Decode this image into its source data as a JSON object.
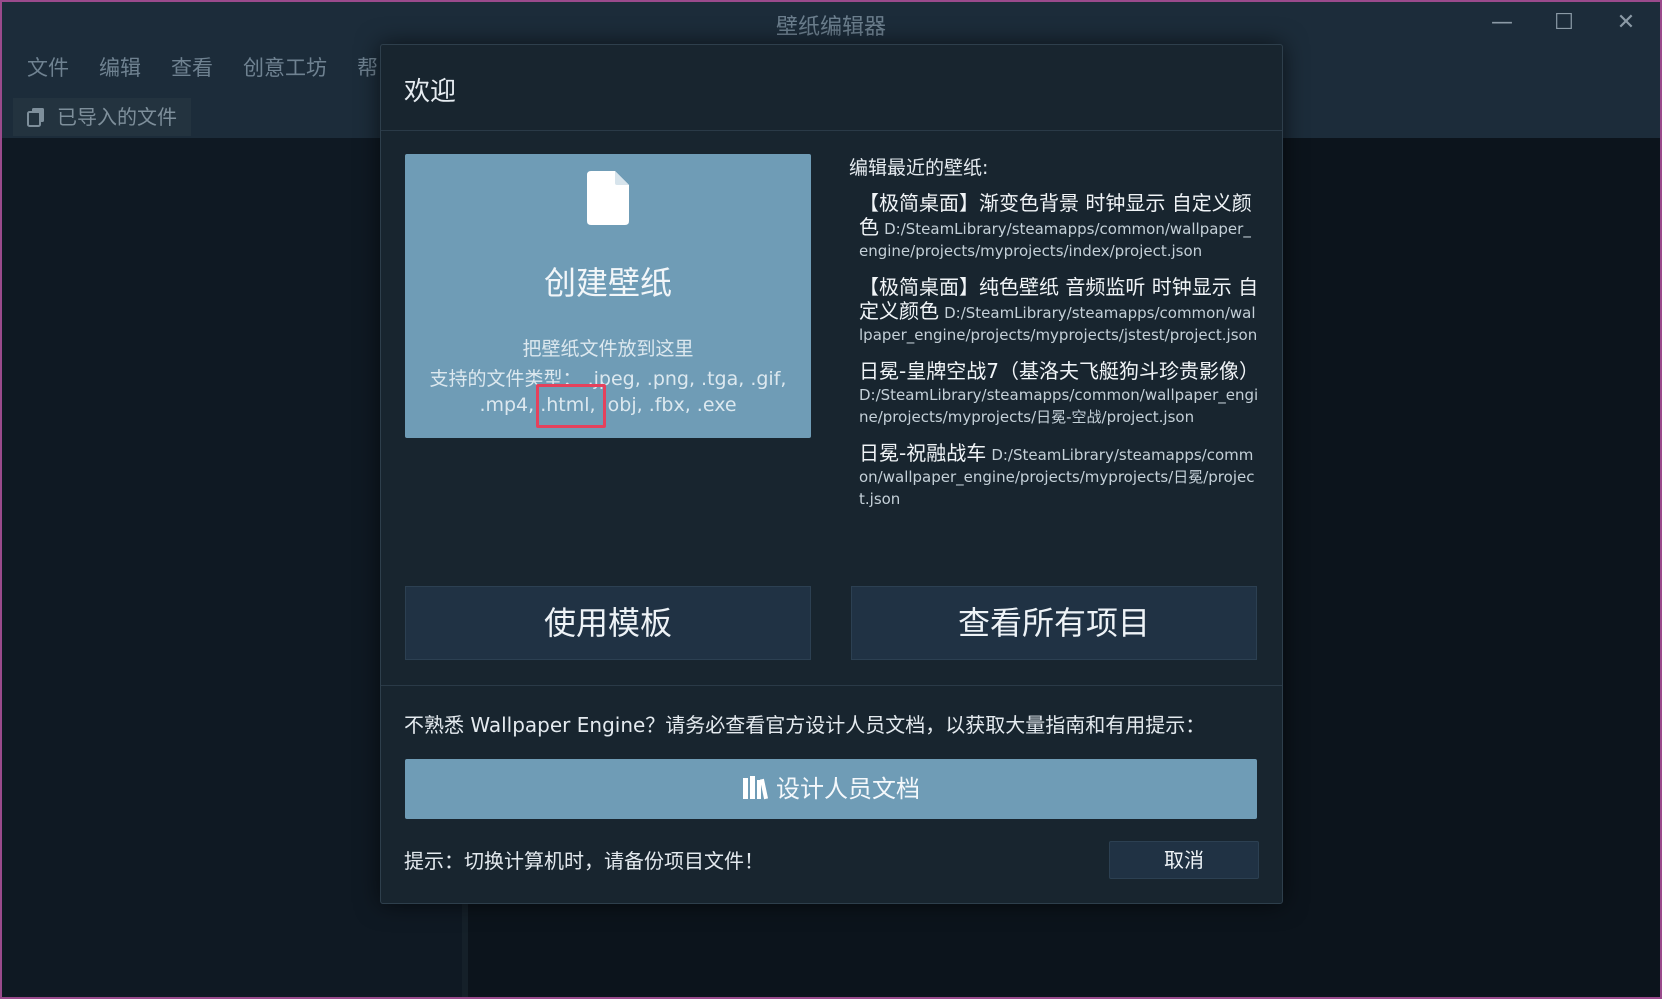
{
  "window": {
    "title": "壁纸编辑器",
    "controls": {
      "minimize": "—",
      "maximize": "☐",
      "close": "✕"
    }
  },
  "menu": [
    "文件",
    "编辑",
    "查看",
    "创意工坊",
    "帮"
  ],
  "tab": {
    "label": "已导入的文件",
    "icon": "copy-icon"
  },
  "dialog": {
    "title": "欢迎",
    "create": {
      "icon": "file-icon",
      "title": "创建壁纸",
      "drop_hint": "把壁纸文件放到这里",
      "types_line1": "支持的文件类型： .jpeg, .png, .tga, .gif,",
      "types_line2": ".mp4, .html, .obj, .fbx, .exe"
    },
    "recent": {
      "heading": "编辑最近的壁纸:",
      "items": [
        {
          "name": "【极简桌面】渐变色背景 时钟显示 自定义颜色",
          "path": "D:/SteamLibrary/steamapps/common/wallpaper_engine/projects/myprojects/index/project.json"
        },
        {
          "name": "【极简桌面】纯色壁纸 音频监听 时钟显示 自定义颜色",
          "path": "D:/SteamLibrary/steamapps/common/wallpaper_engine/projects/myprojects/jstest/project.json"
        },
        {
          "name": "日冕-皇牌空战7（基洛夫飞艇狗斗珍贵影像）",
          "path": "D:/SteamLibrary/steamapps/common/wallpaper_engine/projects/myprojects/日冕-空战/project.json"
        },
        {
          "name": "日冕-祝融战车",
          "path": "D:/SteamLibrary/steamapps/common/wallpaper_engine/projects/myprojects/日冕/project.json"
        }
      ]
    },
    "buttons": {
      "template": "使用模板",
      "all_projects": "查看所有项目",
      "docs": "设计人员文档",
      "cancel": "取消"
    },
    "docs_hint": "不熟悉 Wallpaper Engine？请务必查看官方设计人员文档，以获取大量指南和有用提示：",
    "tip": "提示：切换计算机时，请备份项目文件！"
  },
  "colors": {
    "accent": "#6f9cb6",
    "highlight": "#e5415c",
    "dialog_bg": "#18252f"
  }
}
